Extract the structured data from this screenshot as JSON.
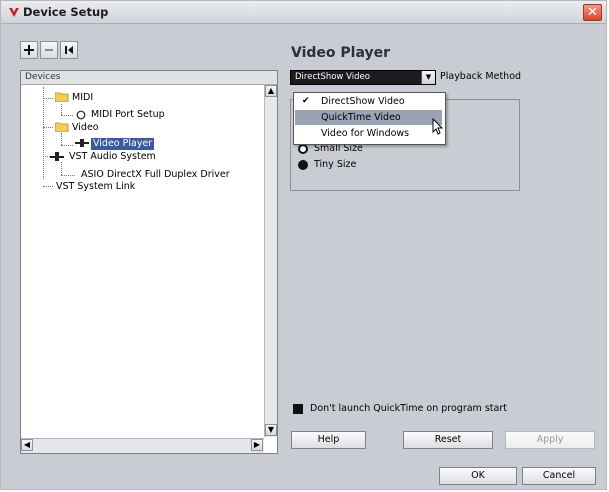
{
  "window": {
    "title": "Device Setup"
  },
  "toolbar": {
    "add": "+",
    "remove": "−",
    "reset": "⏮"
  },
  "devices": {
    "header": "Devices",
    "tree": [
      {
        "label": "MIDI"
      },
      {
        "label": "MIDI Port Setup"
      },
      {
        "label": "Video"
      },
      {
        "label": "Video Player"
      },
      {
        "label": "VST Audio System"
      },
      {
        "label": "ASIO DirectX Full Duplex Driver"
      },
      {
        "label": "VST System Link"
      }
    ]
  },
  "video_player": {
    "title": "Video Player",
    "playback_method_value": "DirectShow Video",
    "playback_method_label": "Playback Method",
    "dropdown_options": [
      {
        "label": "DirectShow Video",
        "checked": true
      },
      {
        "label": "QuickTime Video",
        "hover": true
      },
      {
        "label": "Video for Windows"
      }
    ],
    "sizes": [
      {
        "label": "Small Size",
        "selected": false
      },
      {
        "label": "Tiny Size",
        "selected": true
      }
    ],
    "quicktime_checkbox": "Don't launch QuickTime on program start"
  },
  "buttons": {
    "help": "Help",
    "reset": "Reset",
    "apply": "Apply",
    "ok": "OK",
    "cancel": "Cancel"
  },
  "colors": {
    "selection": "#3c5a9a",
    "hover": "#9aa3b4",
    "close": "#d8482b"
  }
}
